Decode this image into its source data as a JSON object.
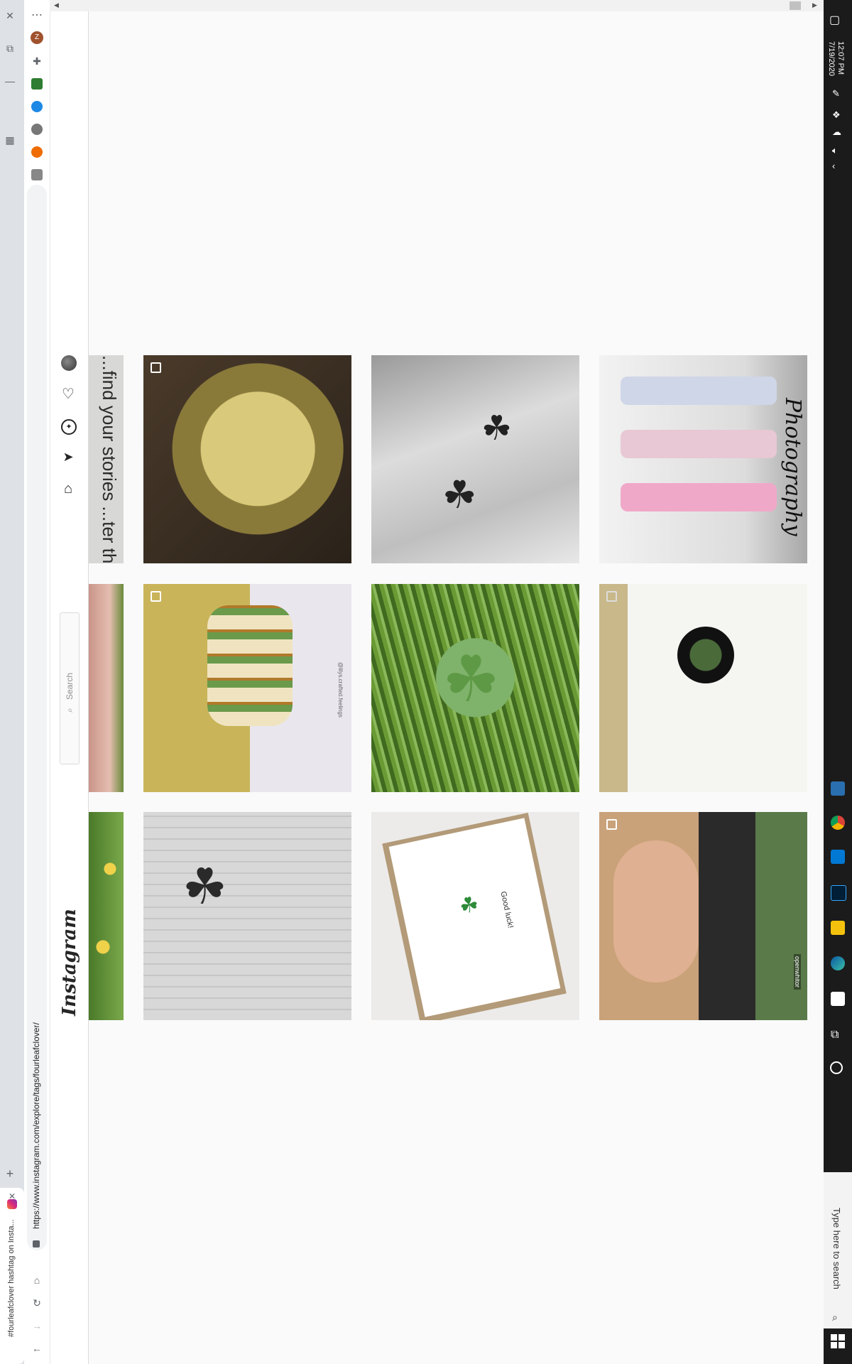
{
  "browser": {
    "tab_title": "#fourleafclover hashtag on Insta...",
    "url": "https://www.instagram.com/explore/tags/fourleafclover/",
    "profile_initial": "Z",
    "new_tab_glyph": "+",
    "close_glyph": "✕",
    "menu_glyph": "⋯"
  },
  "instagram": {
    "logo": "Instagram",
    "search_placeholder": "Search",
    "nav_icons": [
      "home-icon",
      "direct-icon",
      "explore-icon",
      "activity-heart-icon",
      "profile-avatar"
    ]
  },
  "posts": [
    {
      "id": "tea",
      "desc": "glass of tea",
      "multi": true
    },
    {
      "id": "tattoo",
      "desc": "clover tattoo"
    },
    {
      "id": "boys",
      "desc": "three boys",
      "caption": "Photography"
    },
    {
      "id": "bangle",
      "desc": "bangle",
      "multi": true,
      "caption": "@lilys.crafted.feelings"
    },
    {
      "id": "clover-field",
      "desc": "four leaf clover"
    },
    {
      "id": "pendant",
      "desc": "macrame pendant",
      "multi": true
    },
    {
      "id": "bw-clover",
      "desc": "black and white clover"
    },
    {
      "id": "card",
      "desc": "good luck card",
      "caption": "Good luck!"
    },
    {
      "id": "woman",
      "desc": "woman selfie",
      "multi": true,
      "caption": "openwhitor"
    }
  ],
  "partial_posts": [
    {
      "caption": "...find your stories ...ter the ro... andor..."
    },
    {
      "desc": "hand holding clover"
    },
    {
      "desc": "yellow flowers"
    }
  ],
  "taskbar": {
    "time": "12:07 PM",
    "date": "7/19/2020",
    "search_placeholder": "Type here to search"
  },
  "colors": {
    "ig_border": "#dbdbdb",
    "taskbar_bg": "#1b1b1b",
    "page_bg": "#fafafa"
  }
}
